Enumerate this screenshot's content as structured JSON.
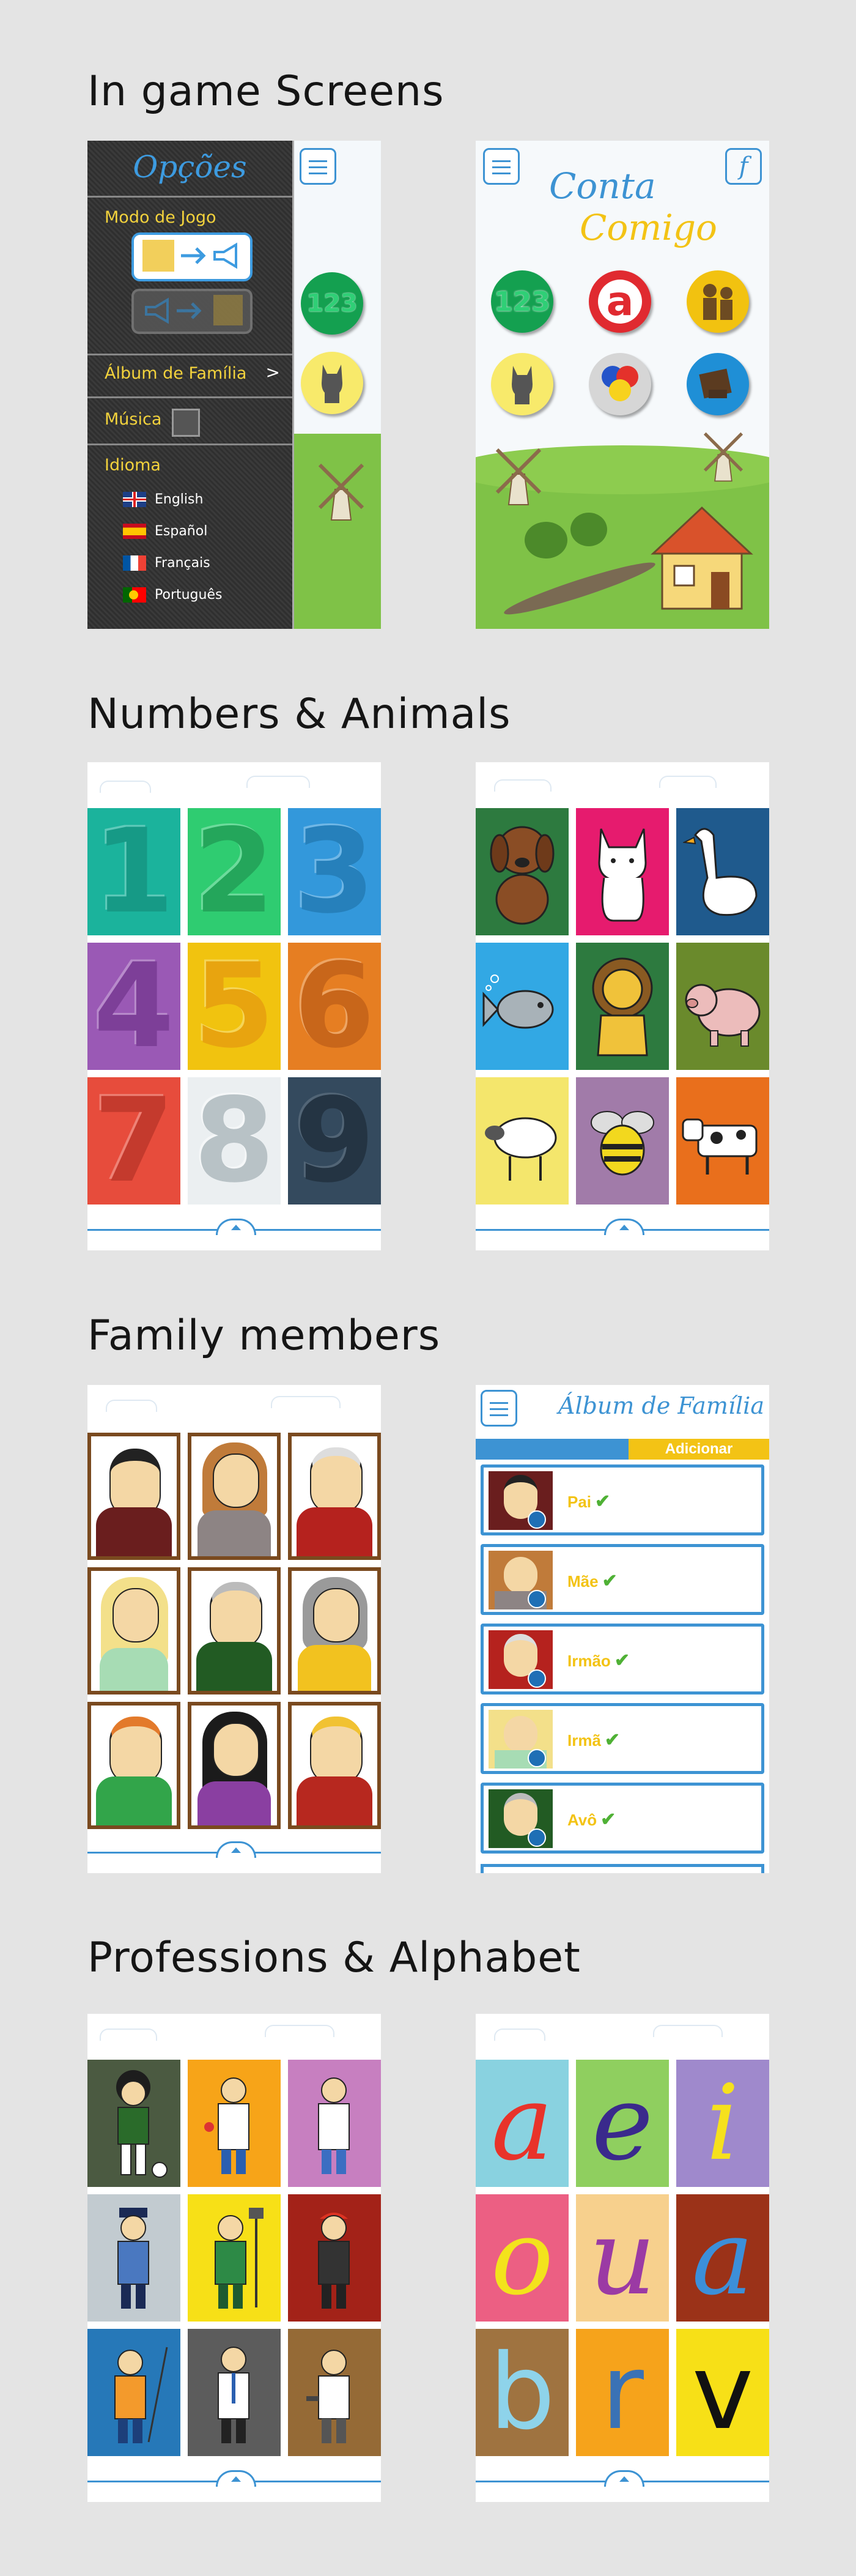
{
  "sections": {
    "in_game": "In game Screens",
    "numbers_animals": "Numbers & Animals",
    "family": "Family members",
    "professions_alphabet": "Professions & Alphabet"
  },
  "options_screen": {
    "title": "Opções",
    "game_mode": "Modo de Jogo",
    "family_album": "Álbum de Família",
    "chevron": ">",
    "music": "Música",
    "language": "Idioma",
    "languages": [
      "English",
      "Español",
      "Français",
      "Português"
    ],
    "peek_number": "123"
  },
  "home_screen": {
    "title_line1": "Conta",
    "title_line2": "Comigo",
    "facebook": "f",
    "numbers_label": "123",
    "letter_label": "a"
  },
  "numbers": [
    "1",
    "2",
    "3",
    "4",
    "5",
    "6",
    "7",
    "8",
    "9"
  ],
  "number_colors": [
    "#1bb39c",
    "#2fcc71",
    "#3398db",
    "#9a59b5",
    "#f1c30f",
    "#e67e22",
    "#e74c3c",
    "#ebeff1",
    "#344a5e"
  ],
  "animal_colors": [
    "#2d7a3f",
    "#e61b6e",
    "#1f5a8d",
    "#32a8e4",
    "#2d7a3f",
    "#6a8a2c",
    "#f4e66c",
    "#a17ba9",
    "#e96f1c"
  ],
  "album_screen": {
    "title": "Álbum de Família",
    "add_button": "Adicionar",
    "members": [
      "Pai",
      "Mãe",
      "Irmão",
      "Irmã",
      "Avô"
    ],
    "check": "✔"
  },
  "profession_colors": [
    "#4b5a41",
    "#f7a418",
    "#c77fc0",
    "#c2cbd0",
    "#f7e017",
    "#a32218",
    "#2678b8",
    "#5c5c5c",
    "#956a36"
  ],
  "letters": [
    "a",
    "e",
    "i",
    "o",
    "u",
    "a",
    "b",
    "r",
    "v"
  ],
  "letter_bg": [
    "#89d2e0",
    "#8fcf5f",
    "#9f89cc",
    "#ec5f83",
    "#f7d08d",
    "#9b3218",
    "#9f7340",
    "#f6a31b",
    "#f7e017"
  ],
  "letter_fg": [
    "#e8332a",
    "#3a2a8c",
    "#f6e11d",
    "#f3e31c",
    "#9b3aa4",
    "#3c8fd9",
    "#8ed3ea",
    "#3a72b5",
    "#111111"
  ]
}
